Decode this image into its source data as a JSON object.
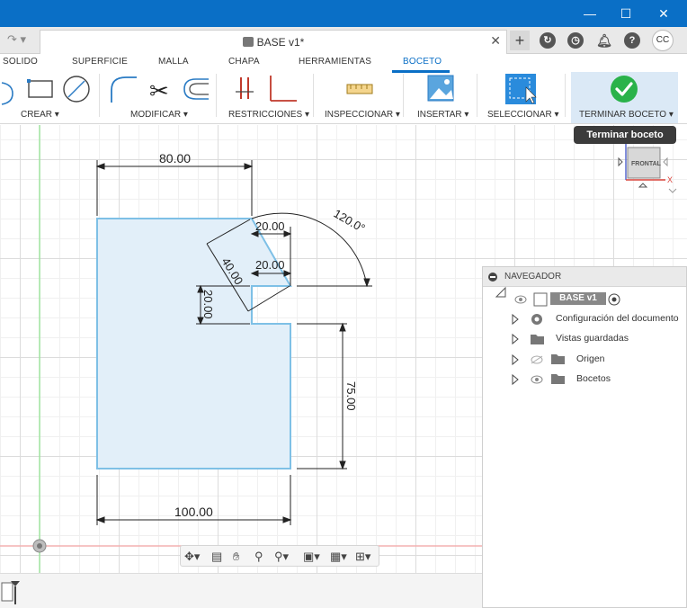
{
  "window": {
    "minimize_glyph": "—",
    "maximize_glyph": "☐",
    "close_glyph": "✕"
  },
  "tabstrip": {
    "undo_glyph": "↷ ▾",
    "doc_title": "BASE v1*",
    "doc_close": "✕",
    "new_tab": "+",
    "user_initials": "CC"
  },
  "ribbon": {
    "tabs": [
      "SOLIDO",
      "SUPERFICIE",
      "MALLA",
      "CHAPA",
      "HERRAMIENTAS",
      "BOCETO"
    ],
    "active_tab": "BOCETO",
    "groups": [
      "CREAR ▾",
      "MODIFICAR ▾",
      "RESTRICCIONES ▾",
      "INSPECCIONAR ▾",
      "INSERTAR ▾",
      "SELECCIONAR ▾",
      "TERMINAR BOCETO ▾"
    ]
  },
  "tooltip": "Terminar boceto",
  "viewcube": {
    "face": "FRONTAL",
    "axis_x": "X"
  },
  "sketch": {
    "dimensions": {
      "top_width": "80.00",
      "step_top": "20.00",
      "step_mid": "20.00",
      "diagonal": "40.00",
      "left_small": "20.00",
      "angle": "120.0°",
      "right_height": "75.00",
      "bottom_width": "100.00"
    }
  },
  "navigator": {
    "title": "NAVEGADOR",
    "root": "BASE v1",
    "items": [
      "Configuración del documento",
      "Vistas guardadas",
      "Origen",
      "Bocetos"
    ]
  },
  "colors": {
    "titlebar": "#0a6fc6",
    "accent": "#0a6fc6",
    "sketch_line": "#7ec0e6",
    "sketch_fill": "#e2eff9",
    "finish_green": "#2ab24a"
  }
}
